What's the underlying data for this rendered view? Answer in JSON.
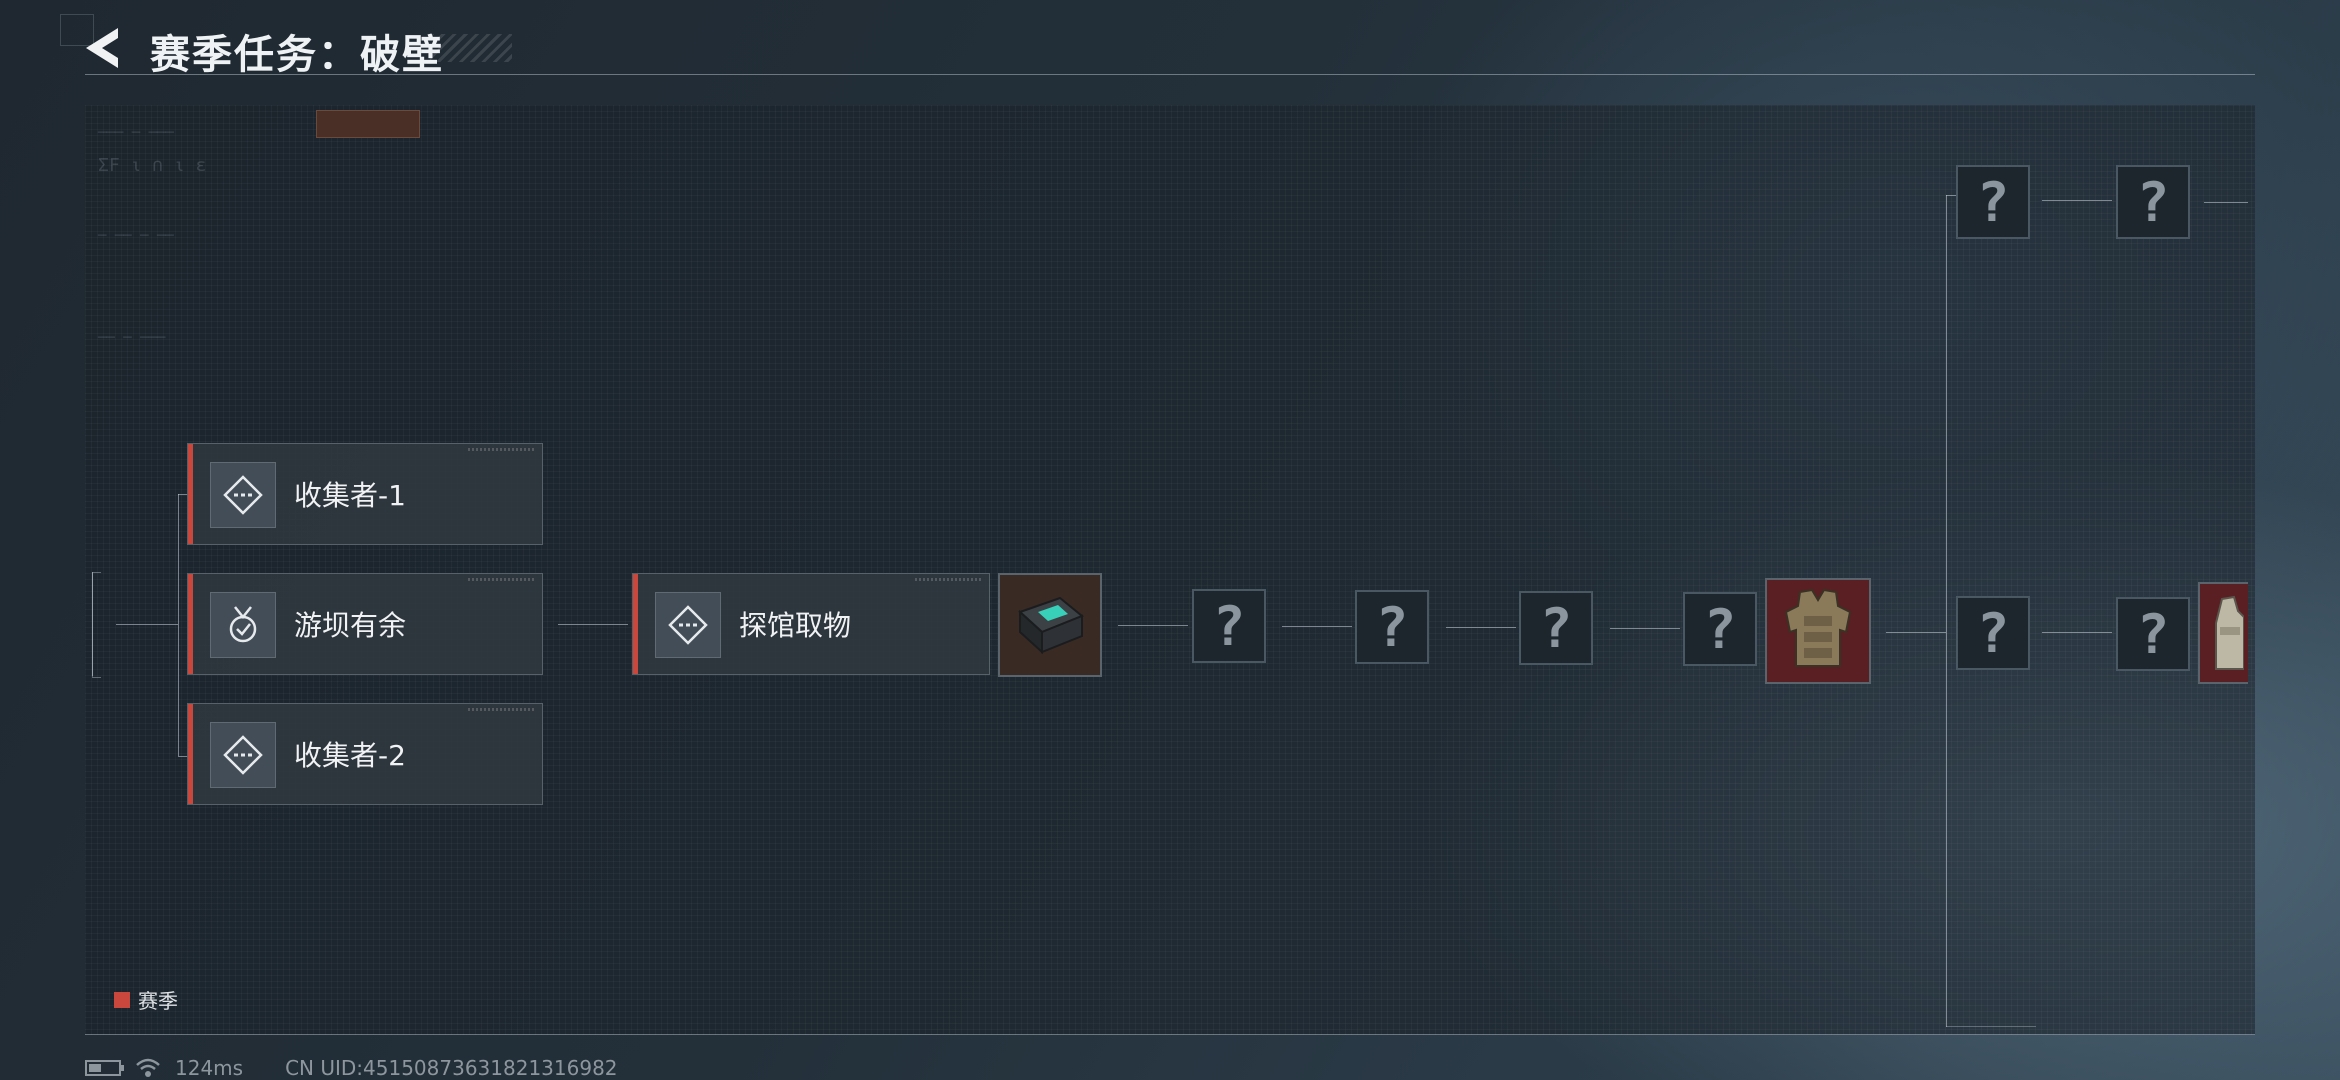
{
  "header": {
    "title": "赛季任务：破壁"
  },
  "tasks": [
    {
      "label": "收集者-1",
      "icon": "diamond-dash-icon"
    },
    {
      "label": "游坝有余",
      "icon": "check-medal-icon"
    },
    {
      "label": "收集者-2",
      "icon": "diamond-dash-icon"
    },
    {
      "label": "探馆取物",
      "icon": "diamond-dash-icon"
    }
  ],
  "mystery_symbol": "?",
  "rewards": [
    {
      "name": "electronic-device-reward",
      "icon": "device-icon"
    },
    {
      "name": "armor-vest-reward",
      "icon": "vest-icon"
    },
    {
      "name": "armor-vest-partial-reward",
      "icon": "vest-icon"
    }
  ],
  "legend": {
    "label": "赛季",
    "color": "#c9473c"
  },
  "status": {
    "ping": "124ms",
    "uid": "CN UID:4515087363182131698​2"
  },
  "colors": {
    "accent": "#c9473c"
  }
}
